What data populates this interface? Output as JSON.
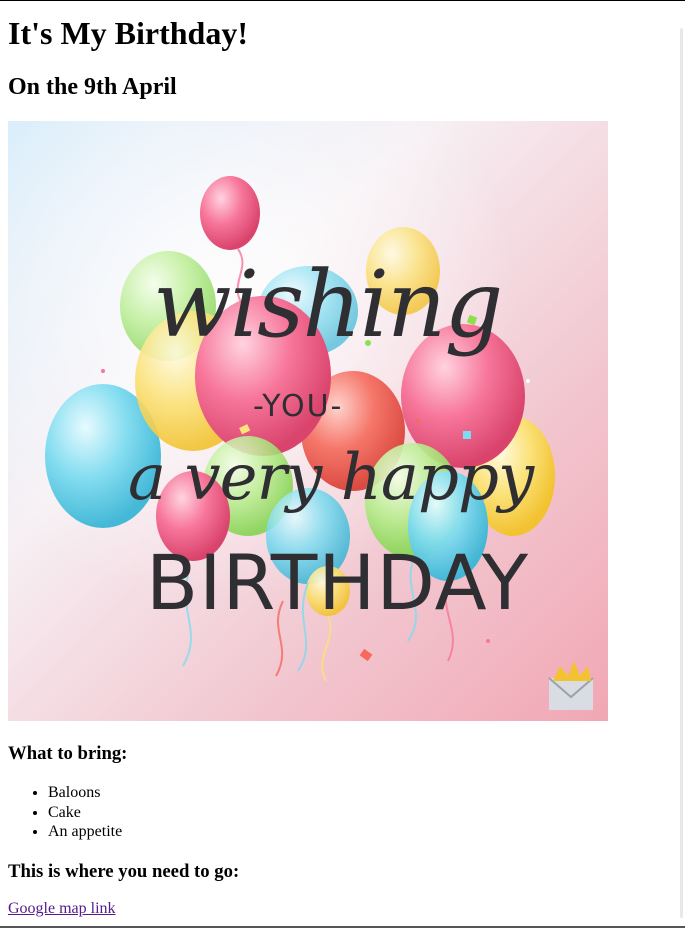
{
  "page": {
    "title": "It's My Birthday!",
    "subtitle": "On the 9th April"
  },
  "card": {
    "line1": "wishing",
    "line2": "-YOU-",
    "line3": "a very happy",
    "line4": "BIRTHDAY"
  },
  "bring": {
    "heading": "What to bring:",
    "items": [
      "Baloons",
      "Cake",
      "An appetite"
    ]
  },
  "directions": {
    "heading": "This is where you need to go:",
    "link_text": "Google map link"
  },
  "colors": {
    "link_visited": "#551a8b",
    "text": "#000000"
  }
}
